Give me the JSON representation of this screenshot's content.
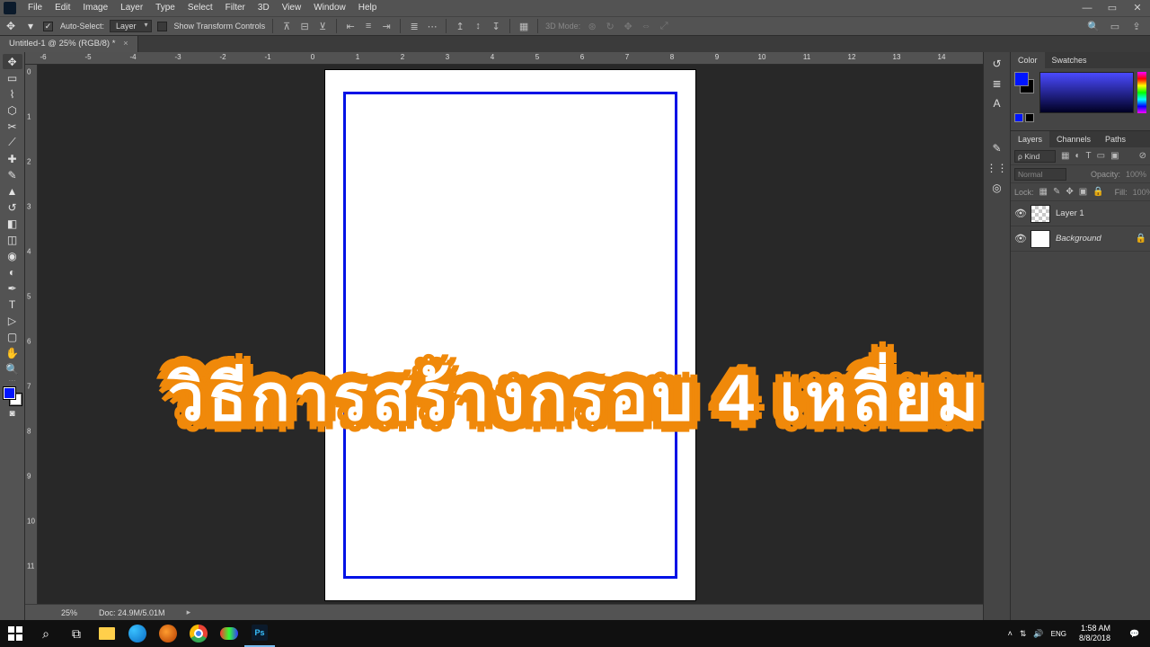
{
  "menu": {
    "items": [
      "File",
      "Edit",
      "Image",
      "Layer",
      "Type",
      "Select",
      "Filter",
      "3D",
      "View",
      "Window",
      "Help"
    ]
  },
  "options": {
    "auto_select": "Auto-Select:",
    "layer_dd": "Layer",
    "show_tc": "Show Transform Controls",
    "mode_3d": "3D Mode:"
  },
  "doc": {
    "tab": "Untitled-1 @ 25% (RGB/8) *"
  },
  "status": {
    "zoom": "25%",
    "doc": "Doc: 24.9M/5.01M"
  },
  "panels": {
    "color_tab": "Color",
    "swatches_tab": "Swatches",
    "layers_tab": "Layers",
    "channels_tab": "Channels",
    "paths_tab": "Paths",
    "kind": "ρ Kind",
    "blend": "Normal",
    "opacity_lbl": "Opacity:",
    "opacity": "100%",
    "lock_lbl": "Lock:",
    "fill_lbl": "Fill:",
    "fill": "100%",
    "layers": [
      {
        "name": "Layer 1",
        "checker": true,
        "locked": false
      },
      {
        "name": "Background",
        "checker": false,
        "locked": true
      }
    ]
  },
  "overlay": "วิธีการสร้างกรอบ 4 เหลี่ยม",
  "taskbar": {
    "time": "1:58 AM",
    "date": "8/8/2018"
  },
  "ruler_h": [
    "-6",
    "-5",
    "-4",
    "-3",
    "-2",
    "-1",
    "0",
    "1",
    "2",
    "3",
    "4",
    "5",
    "6",
    "7",
    "8",
    "9",
    "10",
    "11",
    "12",
    "13",
    "14"
  ],
  "ruler_v": [
    "0",
    "1",
    "2",
    "3",
    "4",
    "5",
    "6",
    "7",
    "8",
    "9",
    "10",
    "11"
  ],
  "colors": {
    "fg": "#0015ff",
    "bg": "#ffffff",
    "accent": "#f0890a",
    "frame": "#0012e6"
  }
}
